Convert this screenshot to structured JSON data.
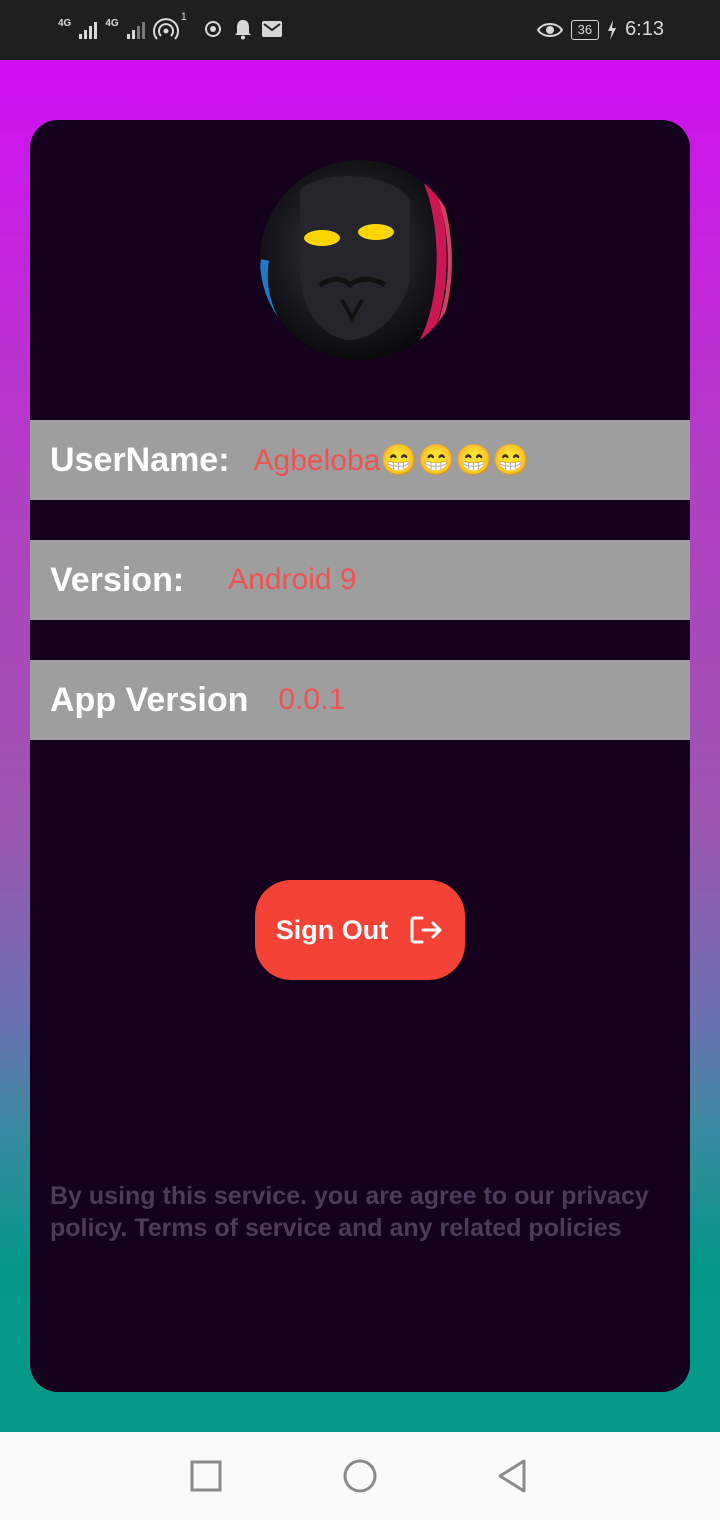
{
  "status_bar": {
    "network1": "4G",
    "network2": "4G",
    "hotspot_badge": "1",
    "battery": "36",
    "time": "6:13"
  },
  "profile": {
    "username_label": "UserName:",
    "username_value": "Agbeloba😁😁😁😁",
    "version_label": "Version:",
    "version_value": "Android 9",
    "app_version_label": "App Version",
    "app_version_value": "0.0.1"
  },
  "actions": {
    "sign_out_label": "Sign Out"
  },
  "footer": {
    "policy_text": "By using this service. you are agree to our privacy policy. Terms of service and any related policies"
  },
  "colors": {
    "card_bg": "#14001c",
    "row_bg": "#9e9e9e",
    "value_text": "#ef5350",
    "button_bg": "#f44336"
  },
  "icons": [
    "signal-icon",
    "hotspot-icon",
    "notification-icon",
    "mail-icon",
    "eye-icon",
    "charging-icon",
    "sign-out-icon",
    "nav-recents-icon",
    "nav-home-icon",
    "nav-back-icon"
  ]
}
